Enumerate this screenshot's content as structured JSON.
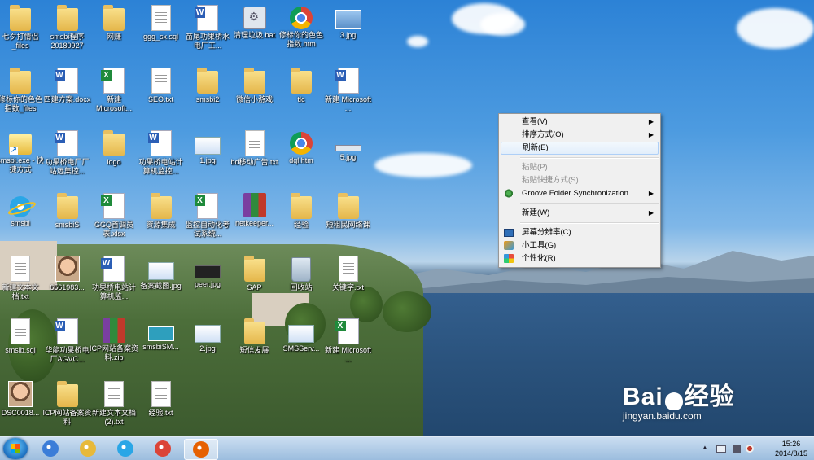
{
  "desktop": {
    "icons": [
      {
        "label": "七夕打情侣_files",
        "type": "folder"
      },
      {
        "label": "smsbi程序20180927",
        "type": "folder"
      },
      {
        "label": "网赚",
        "type": "folder"
      },
      {
        "label": "ggg_sx.sql",
        "type": "doc"
      },
      {
        "label": "苗尾功果桥水电厂工...",
        "type": "word"
      },
      {
        "label": "清理垃圾.bat",
        "type": "bat"
      },
      {
        "label": "修标你的色色指数.htm",
        "type": "chrome"
      },
      {
        "label": "3.jpg",
        "type": "img"
      },
      {
        "label": "修标你的色色指数_files",
        "type": "folder"
      },
      {
        "label": "四建方案.docx",
        "type": "word"
      },
      {
        "label": "新建 Microsoft...",
        "type": "excel"
      },
      {
        "label": "SEO.txt",
        "type": "doc"
      },
      {
        "label": "smsbi2",
        "type": "folder"
      },
      {
        "label": "微信小游戏",
        "type": "folder"
      },
      {
        "label": "tlc",
        "type": "folder"
      },
      {
        "label": "新建 Microsoft ...",
        "type": "word"
      },
      {
        "label": "smsbi.exe - 快捷方式",
        "type": "shortcut"
      },
      {
        "label": "功果桥电厂厂站远集控...",
        "type": "word"
      },
      {
        "label": "logo",
        "type": "folder"
      },
      {
        "label": "功果桥电站计算机监控...",
        "type": "word"
      },
      {
        "label": "1.jpg",
        "type": "card"
      },
      {
        "label": "bd移动广告.txt",
        "type": "doc"
      },
      {
        "label": "dql.htm",
        "type": "chrome"
      },
      {
        "label": "5.jpg",
        "type": "thin"
      },
      {
        "label": "smsbi",
        "type": "ie"
      },
      {
        "label": "smsbiS",
        "type": "folder"
      },
      {
        "label": "GGQ首调员表.xlsx",
        "type": "excel"
      },
      {
        "label": "资源集成",
        "type": "folder"
      },
      {
        "label": "监控自动化考试系统...",
        "type": "excel"
      },
      {
        "label": "netkeeper...",
        "type": "zip"
      },
      {
        "label": "经验",
        "type": "folder"
      },
      {
        "label": "短租民网络课",
        "type": "folder"
      },
      {
        "label": "新建文本文档.txt",
        "type": "doc"
      },
      {
        "label": "6561983...",
        "type": "photo"
      },
      {
        "label": "功果桥电站计算机监...",
        "type": "word"
      },
      {
        "label": "备案截图.jpg",
        "type": "card"
      },
      {
        "label": "peer.jpg",
        "type": "dark"
      },
      {
        "label": "SAP",
        "type": "folder"
      },
      {
        "label": "回收站",
        "type": "recycle"
      },
      {
        "label": "关键字.txt",
        "type": "doc"
      },
      {
        "label": "smsib.sql",
        "type": "doc"
      },
      {
        "label": "华能功果桥电厂AGVC...",
        "type": "word"
      },
      {
        "label": "ICP网站备案资料.zip",
        "type": "zip"
      },
      {
        "label": "smsbiSM...",
        "type": "teal"
      },
      {
        "label": "2.jpg",
        "type": "card"
      },
      {
        "label": "短信发展",
        "type": "folder"
      },
      {
        "label": "SMSServ...",
        "type": "card"
      },
      {
        "label": "新建 Microsoft ...",
        "type": "excel"
      },
      {
        "label": "DSC0018...",
        "type": "photo"
      },
      {
        "label": "ICP网站备案资料",
        "type": "folder"
      },
      {
        "label": "新建文本文档 (2).txt",
        "type": "doc"
      },
      {
        "label": "经验.txt",
        "type": "doc"
      }
    ]
  },
  "context_menu": {
    "items": [
      {
        "label": "查看(V)",
        "submenu": true,
        "disabled": false,
        "hover": false,
        "icon": ""
      },
      {
        "label": "排序方式(O)",
        "submenu": true,
        "disabled": false,
        "hover": false,
        "icon": ""
      },
      {
        "label": "刷新(E)",
        "submenu": false,
        "disabled": false,
        "hover": true,
        "icon": ""
      },
      {
        "sep": true
      },
      {
        "label": "粘贴(P)",
        "submenu": false,
        "disabled": true,
        "hover": false,
        "icon": ""
      },
      {
        "label": "粘贴快捷方式(S)",
        "submenu": false,
        "disabled": true,
        "hover": false,
        "icon": ""
      },
      {
        "label": "Groove Folder Synchronization",
        "submenu": true,
        "disabled": false,
        "hover": false,
        "icon": "groove-icon"
      },
      {
        "sep": true
      },
      {
        "label": "新建(W)",
        "submenu": true,
        "disabled": false,
        "hover": false,
        "icon": ""
      },
      {
        "sep": true
      },
      {
        "label": "屏幕分辨率(C)",
        "submenu": false,
        "disabled": false,
        "hover": false,
        "icon": "monitor-icon"
      },
      {
        "label": "小工具(G)",
        "submenu": false,
        "disabled": false,
        "hover": false,
        "icon": "gadget-icon"
      },
      {
        "label": "个性化(R)",
        "submenu": false,
        "disabled": false,
        "hover": false,
        "icon": "personalize-icon"
      }
    ]
  },
  "taskbar": {
    "apps": [
      {
        "name": "app-icon",
        "color": "#3b7dd8",
        "active": false
      },
      {
        "name": "explorer-icon",
        "color": "#e7b93a",
        "active": false
      },
      {
        "name": "ie-icon",
        "color": "#2aa6e6",
        "active": false
      },
      {
        "name": "chrome-icon",
        "color": "#db4437",
        "active": false
      },
      {
        "name": "firefox-icon",
        "color": "#e66000",
        "active": true
      }
    ],
    "clock_time": "15:26",
    "clock_date": "2014/8/15"
  },
  "watermark": {
    "logo_text": "Bai",
    "logo_text2": "经验",
    "url": "jingyan.baidu.com"
  }
}
